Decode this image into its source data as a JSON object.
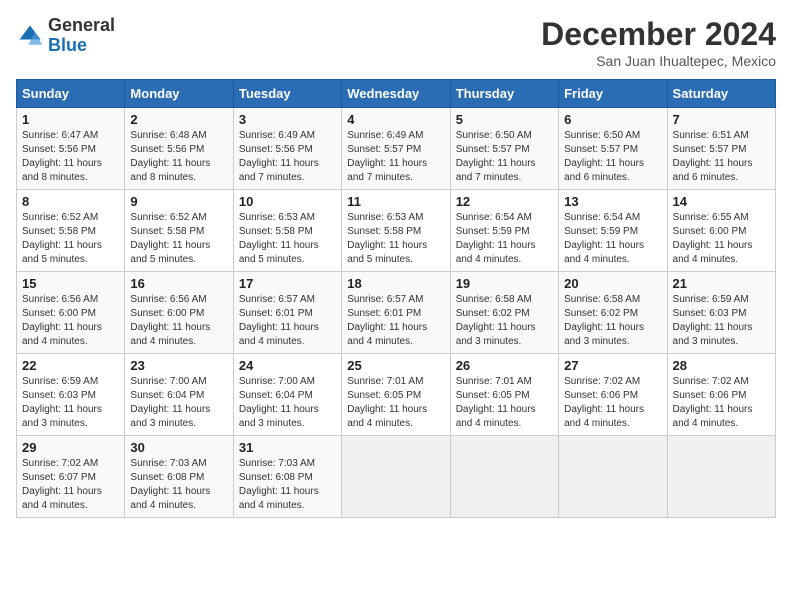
{
  "header": {
    "logo_general": "General",
    "logo_blue": "Blue",
    "month_title": "December 2024",
    "location": "San Juan Ihualtepec, Mexico"
  },
  "weekdays": [
    "Sunday",
    "Monday",
    "Tuesday",
    "Wednesday",
    "Thursday",
    "Friday",
    "Saturday"
  ],
  "weeks": [
    [
      {
        "day": "1",
        "sunrise": "6:47 AM",
        "sunset": "5:56 PM",
        "daylight": "11 hours and 8 minutes."
      },
      {
        "day": "2",
        "sunrise": "6:48 AM",
        "sunset": "5:56 PM",
        "daylight": "11 hours and 8 minutes."
      },
      {
        "day": "3",
        "sunrise": "6:49 AM",
        "sunset": "5:56 PM",
        "daylight": "11 hours and 7 minutes."
      },
      {
        "day": "4",
        "sunrise": "6:49 AM",
        "sunset": "5:57 PM",
        "daylight": "11 hours and 7 minutes."
      },
      {
        "day": "5",
        "sunrise": "6:50 AM",
        "sunset": "5:57 PM",
        "daylight": "11 hours and 7 minutes."
      },
      {
        "day": "6",
        "sunrise": "6:50 AM",
        "sunset": "5:57 PM",
        "daylight": "11 hours and 6 minutes."
      },
      {
        "day": "7",
        "sunrise": "6:51 AM",
        "sunset": "5:57 PM",
        "daylight": "11 hours and 6 minutes."
      }
    ],
    [
      {
        "day": "8",
        "sunrise": "6:52 AM",
        "sunset": "5:58 PM",
        "daylight": "11 hours and 5 minutes."
      },
      {
        "day": "9",
        "sunrise": "6:52 AM",
        "sunset": "5:58 PM",
        "daylight": "11 hours and 5 minutes."
      },
      {
        "day": "10",
        "sunrise": "6:53 AM",
        "sunset": "5:58 PM",
        "daylight": "11 hours and 5 minutes."
      },
      {
        "day": "11",
        "sunrise": "6:53 AM",
        "sunset": "5:58 PM",
        "daylight": "11 hours and 5 minutes."
      },
      {
        "day": "12",
        "sunrise": "6:54 AM",
        "sunset": "5:59 PM",
        "daylight": "11 hours and 4 minutes."
      },
      {
        "day": "13",
        "sunrise": "6:54 AM",
        "sunset": "5:59 PM",
        "daylight": "11 hours and 4 minutes."
      },
      {
        "day": "14",
        "sunrise": "6:55 AM",
        "sunset": "6:00 PM",
        "daylight": "11 hours and 4 minutes."
      }
    ],
    [
      {
        "day": "15",
        "sunrise": "6:56 AM",
        "sunset": "6:00 PM",
        "daylight": "11 hours and 4 minutes."
      },
      {
        "day": "16",
        "sunrise": "6:56 AM",
        "sunset": "6:00 PM",
        "daylight": "11 hours and 4 minutes."
      },
      {
        "day": "17",
        "sunrise": "6:57 AM",
        "sunset": "6:01 PM",
        "daylight": "11 hours and 4 minutes."
      },
      {
        "day": "18",
        "sunrise": "6:57 AM",
        "sunset": "6:01 PM",
        "daylight": "11 hours and 4 minutes."
      },
      {
        "day": "19",
        "sunrise": "6:58 AM",
        "sunset": "6:02 PM",
        "daylight": "11 hours and 3 minutes."
      },
      {
        "day": "20",
        "sunrise": "6:58 AM",
        "sunset": "6:02 PM",
        "daylight": "11 hours and 3 minutes."
      },
      {
        "day": "21",
        "sunrise": "6:59 AM",
        "sunset": "6:03 PM",
        "daylight": "11 hours and 3 minutes."
      }
    ],
    [
      {
        "day": "22",
        "sunrise": "6:59 AM",
        "sunset": "6:03 PM",
        "daylight": "11 hours and 3 minutes."
      },
      {
        "day": "23",
        "sunrise": "7:00 AM",
        "sunset": "6:04 PM",
        "daylight": "11 hours and 3 minutes."
      },
      {
        "day": "24",
        "sunrise": "7:00 AM",
        "sunset": "6:04 PM",
        "daylight": "11 hours and 3 minutes."
      },
      {
        "day": "25",
        "sunrise": "7:01 AM",
        "sunset": "6:05 PM",
        "daylight": "11 hours and 4 minutes."
      },
      {
        "day": "26",
        "sunrise": "7:01 AM",
        "sunset": "6:05 PM",
        "daylight": "11 hours and 4 minutes."
      },
      {
        "day": "27",
        "sunrise": "7:02 AM",
        "sunset": "6:06 PM",
        "daylight": "11 hours and 4 minutes."
      },
      {
        "day": "28",
        "sunrise": "7:02 AM",
        "sunset": "6:06 PM",
        "daylight": "11 hours and 4 minutes."
      }
    ],
    [
      {
        "day": "29",
        "sunrise": "7:02 AM",
        "sunset": "6:07 PM",
        "daylight": "11 hours and 4 minutes."
      },
      {
        "day": "30",
        "sunrise": "7:03 AM",
        "sunset": "6:08 PM",
        "daylight": "11 hours and 4 minutes."
      },
      {
        "day": "31",
        "sunrise": "7:03 AM",
        "sunset": "6:08 PM",
        "daylight": "11 hours and 4 minutes."
      },
      null,
      null,
      null,
      null
    ]
  ],
  "labels": {
    "sunrise": "Sunrise:",
    "sunset": "Sunset:",
    "daylight": "Daylight:"
  }
}
